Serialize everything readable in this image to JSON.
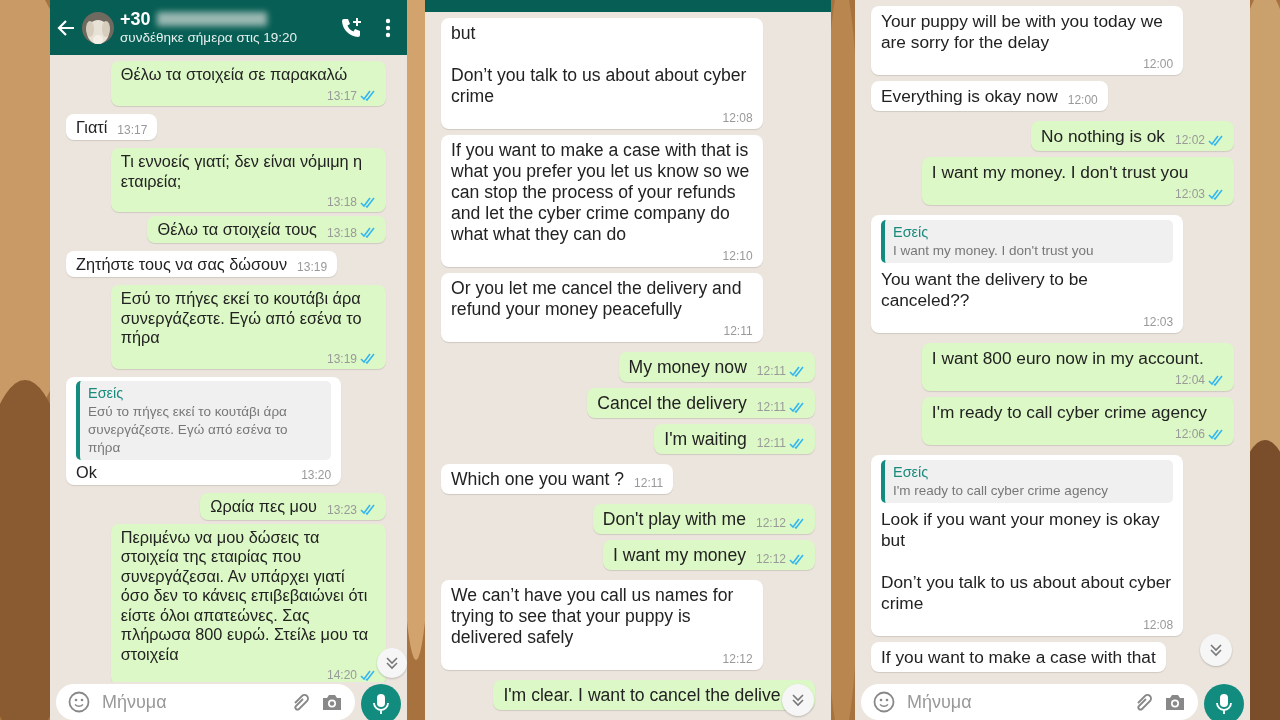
{
  "panels": [
    {
      "header": {
        "title": "+30",
        "status": "συνδέθηκε σήμερα στις 19:20",
        "number_redacted": true
      },
      "header_strip": false,
      "messages": [
        {
          "kind": "out",
          "text": "Θέλω τα στοιχεία σε παρακαλώ",
          "time": "13:17",
          "read": true
        },
        {
          "kind": "in",
          "text": "Γιατί",
          "time": "13:17"
        },
        {
          "kind": "out",
          "text": "Τι εννοείς γιατί; δεν είναι νόμιμη η εταιρεία;",
          "time": "13:18",
          "read": true
        },
        {
          "kind": "out",
          "text": "Θέλω τα στοιχεία τους",
          "time": "13:18",
          "read": true
        },
        {
          "kind": "in",
          "text": "Ζητήστε τους να σας δώσουν",
          "time": "13:19"
        },
        {
          "kind": "out",
          "text": "Εσύ το πήγες εκεί το κουτάβι άρα συνεργάζεστε. Εγώ από εσένα το πήρα",
          "time": "13:19",
          "read": true
        },
        {
          "kind": "in",
          "quote": {
            "author": "Εσείς",
            "text": "Εσύ το πήγες εκεί το κουτάβι άρα συνεργάζεστε. Εγώ από εσένα το πήρα"
          },
          "text": "Ok",
          "time": "13:20"
        },
        {
          "kind": "out",
          "text": "Ωραία πες μου",
          "time": "13:23",
          "read": true
        },
        {
          "kind": "out",
          "text": "Περιμένω να μου δώσεις τα στοιχεία της εταιρίας που συνεργάζεσαι. Αν υπάρχει γιατί όσο δεν το κάνεις επιβεβαιώνει ότι είστε όλοι απατεώνες. Σας πλήρωσα 800 ευρώ. Στείλε μου τα στοιχεία",
          "time": "14:20",
          "read": true
        }
      ],
      "composer": {
        "placeholder": "Μήνυμα"
      }
    },
    {
      "header_strip": true,
      "messages": [
        {
          "kind": "in",
          "text": "but\n\nDon’t you talk to us about about cyber crime",
          "time": "12:08"
        },
        {
          "kind": "in",
          "text": "If you want to make a case with that is what you prefer you let us know so we can stop the process of your refunds and let the cyber crime company do what what they can do",
          "time": "12:10"
        },
        {
          "kind": "in",
          "text": "Or you let me cancel the delivery and refund your money peacefully",
          "time": "12:11"
        },
        {
          "kind": "out",
          "text": "My money now",
          "time": "12:11",
          "read": true
        },
        {
          "kind": "out",
          "text": "Cancel the delivery",
          "time": "12:11",
          "read": true
        },
        {
          "kind": "out",
          "text": "I'm waiting",
          "time": "12:11",
          "read": true
        },
        {
          "kind": "in",
          "text": "Which one you want ?",
          "time": "12:11"
        },
        {
          "kind": "out",
          "text": "Don't play with me",
          "time": "12:12",
          "read": true
        },
        {
          "kind": "out",
          "text": "I want my money",
          "time": "12:12",
          "read": true
        },
        {
          "kind": "in",
          "text": "We can’t have you call us names for trying to see that your puppy is delivered safely",
          "time": "12:12"
        },
        {
          "kind": "out",
          "text": "I'm clear. I want to cancel the delive"
        }
      ]
    },
    {
      "header_strip": false,
      "messages": [
        {
          "kind": "in",
          "text": "Your puppy will be with you today we are sorry for the delay",
          "time": "12:00"
        },
        {
          "kind": "in",
          "text": "Everything is okay now",
          "time": "12:00"
        },
        {
          "kind": "out",
          "text": "No nothing is ok",
          "time": "12:02",
          "read": true
        },
        {
          "kind": "out",
          "text": "I want my money. I don't trust you",
          "time": "12:03",
          "read": true
        },
        {
          "kind": "in",
          "quote": {
            "author": "Εσείς",
            "text": "I want my money. I don't trust you"
          },
          "text": "You want the delivery to be canceled??",
          "time": "12:03"
        },
        {
          "kind": "out",
          "text": "I want 800 euro now in my account.",
          "time": "12:04",
          "read": true
        },
        {
          "kind": "out",
          "text": "I'm ready to call cyber crime agency",
          "time": "12:06",
          "read": true
        },
        {
          "kind": "in",
          "quote": {
            "author": "Εσείς",
            "text": "I'm ready to call cyber crime agency"
          },
          "text": "Look if you want your money is okay but\n\nDon’t you talk to us about about cyber crime",
          "time": "12:08"
        },
        {
          "kind": "in",
          "text": "If you want to make a case with that"
        }
      ],
      "composer": {
        "placeholder": "Μήνυμα"
      }
    }
  ]
}
